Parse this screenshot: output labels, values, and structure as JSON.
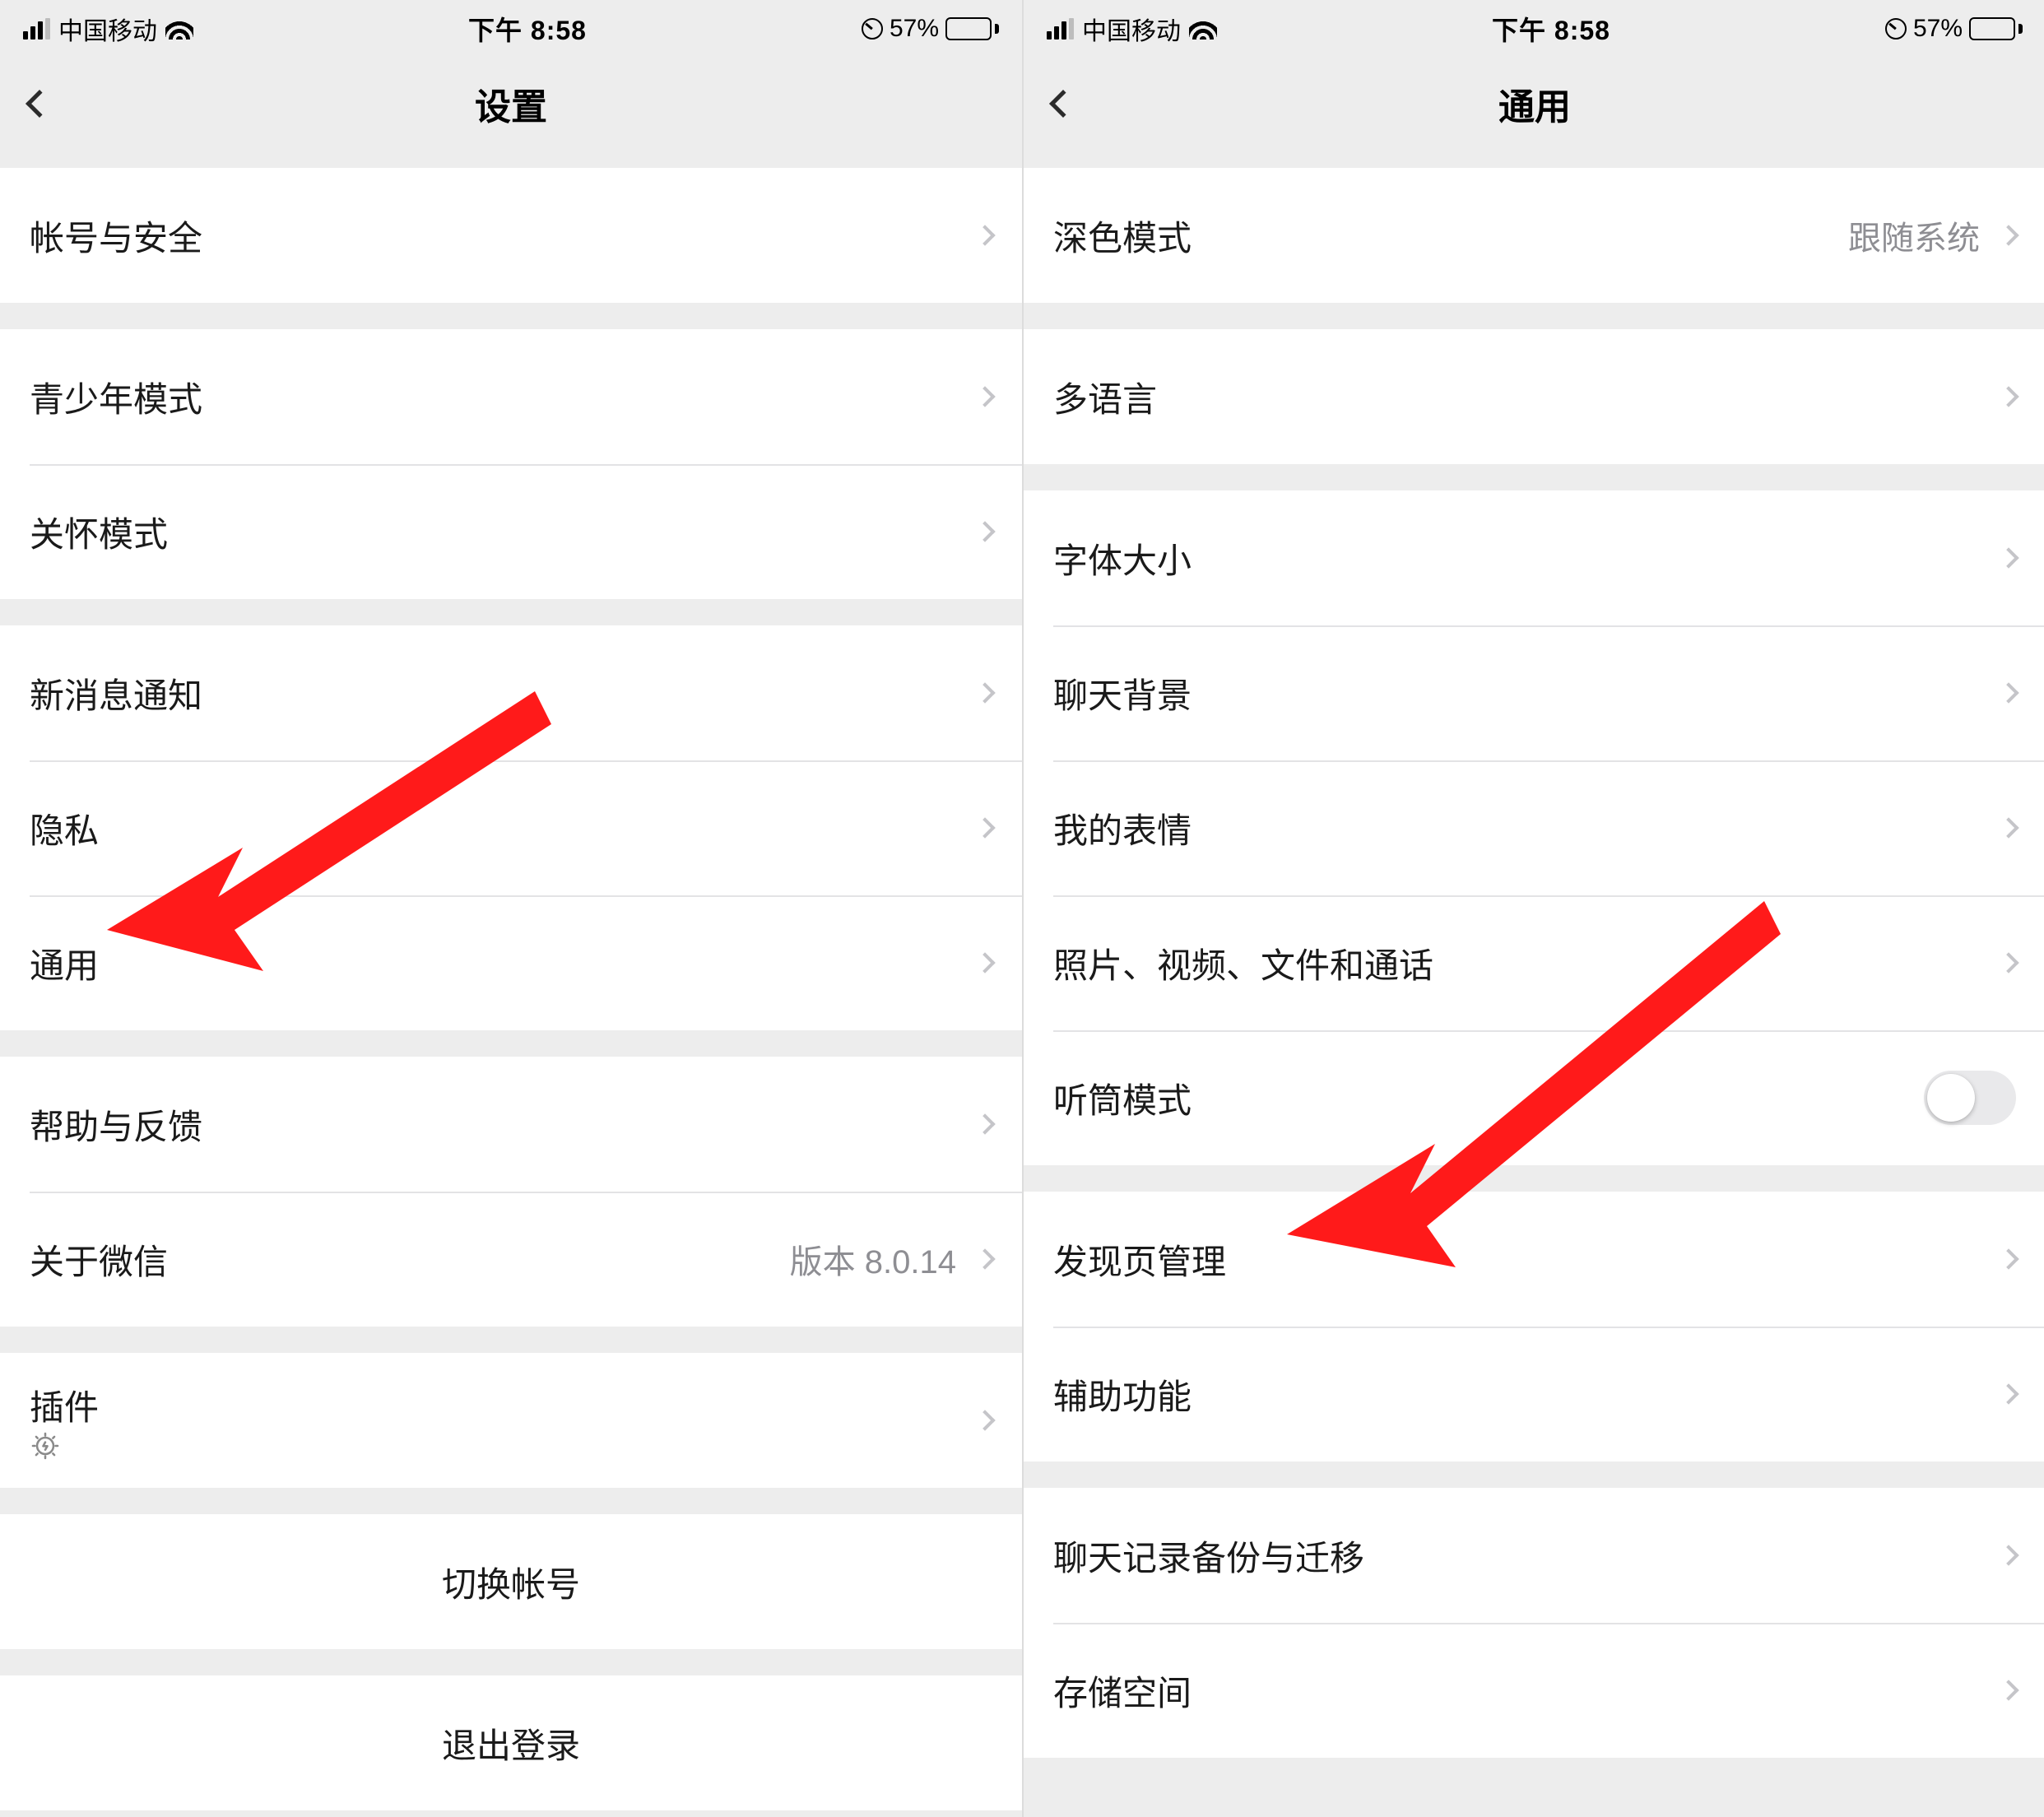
{
  "status_bar": {
    "carrier": "中国移动",
    "time": "下午 8:58",
    "battery_pct": "57%"
  },
  "left": {
    "title": "设置",
    "rows": {
      "account_security": "帐号与安全",
      "teen_mode": "青少年模式",
      "care_mode": "关怀模式",
      "notifications": "新消息通知",
      "privacy": "隐私",
      "general": "通用",
      "help_feedback": "帮助与反馈",
      "about": "关于微信",
      "about_value": "版本 8.0.14",
      "plugins": "插件",
      "switch_account": "切换帐号",
      "logout": "退出登录"
    }
  },
  "right": {
    "title": "通用",
    "rows": {
      "dark_mode": "深色模式",
      "dark_mode_value": "跟随系统",
      "language": "多语言",
      "font_size": "字体大小",
      "chat_bg": "聊天背景",
      "stickers": "我的表情",
      "media_files_calls": "照片、视频、文件和通话",
      "earpiece_mode": "听筒模式",
      "discover_mgmt": "发现页管理",
      "accessibility": "辅助功能",
      "chat_backup": "聊天记录备份与迁移",
      "storage": "存储空间"
    }
  },
  "annotations": {
    "arrow_color": "#ff1a1a"
  }
}
